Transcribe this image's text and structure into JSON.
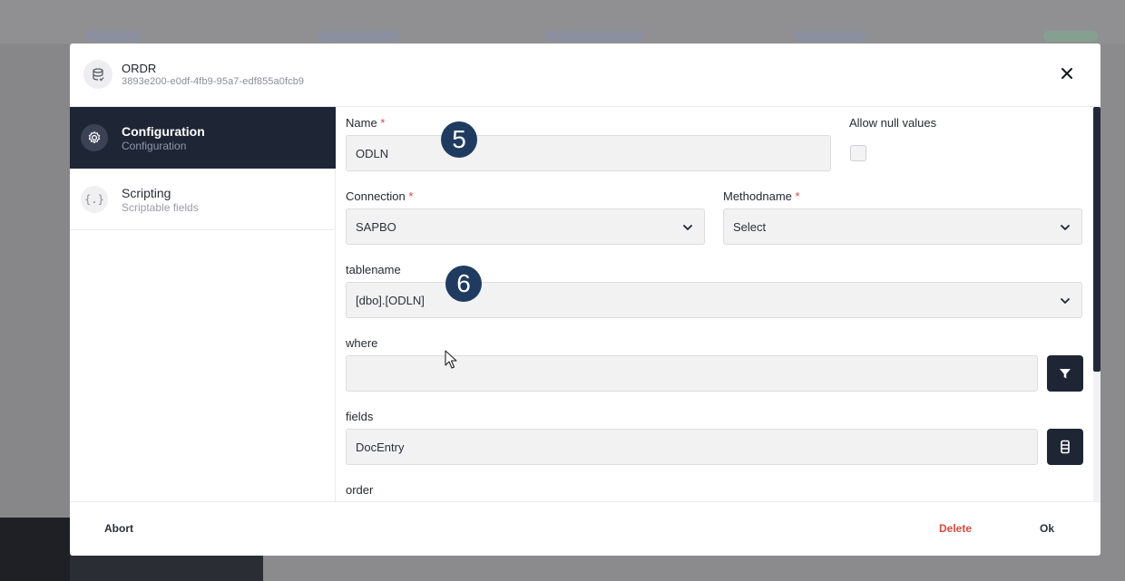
{
  "dialog": {
    "title": "ORDR",
    "id": "3893e200-e0df-4fb9-95a7-edf855a0fcb9"
  },
  "sidebar": {
    "items": [
      {
        "label": "Configuration",
        "sub": "Configuration",
        "icon": "gear-icon",
        "active": true
      },
      {
        "label": "Scripting",
        "sub": "Scriptable fields",
        "icon": "braces-icon",
        "active": false
      }
    ]
  },
  "form": {
    "name": {
      "label": "Name",
      "required": "*",
      "value": "ODLN"
    },
    "allow_null": {
      "label": "Allow null values",
      "checked": false
    },
    "connection": {
      "label": "Connection",
      "required": "*",
      "value": "SAPBO"
    },
    "methodname": {
      "label": "Methodname",
      "required": "*",
      "value": "Select"
    },
    "tablename": {
      "label": "tablename",
      "value": "[dbo].[ODLN]"
    },
    "where": {
      "label": "where",
      "value": ""
    },
    "fields": {
      "label": "fields",
      "value": "DocEntry"
    },
    "order": {
      "label": "order"
    }
  },
  "badges": {
    "step5": "5",
    "step6": "6"
  },
  "footer": {
    "abort": "Abort",
    "delete": "Delete",
    "ok": "Ok"
  },
  "colors": {
    "primary_dark": "#1e2535",
    "danger": "#d74a3d",
    "badge": "#1f3c60"
  }
}
